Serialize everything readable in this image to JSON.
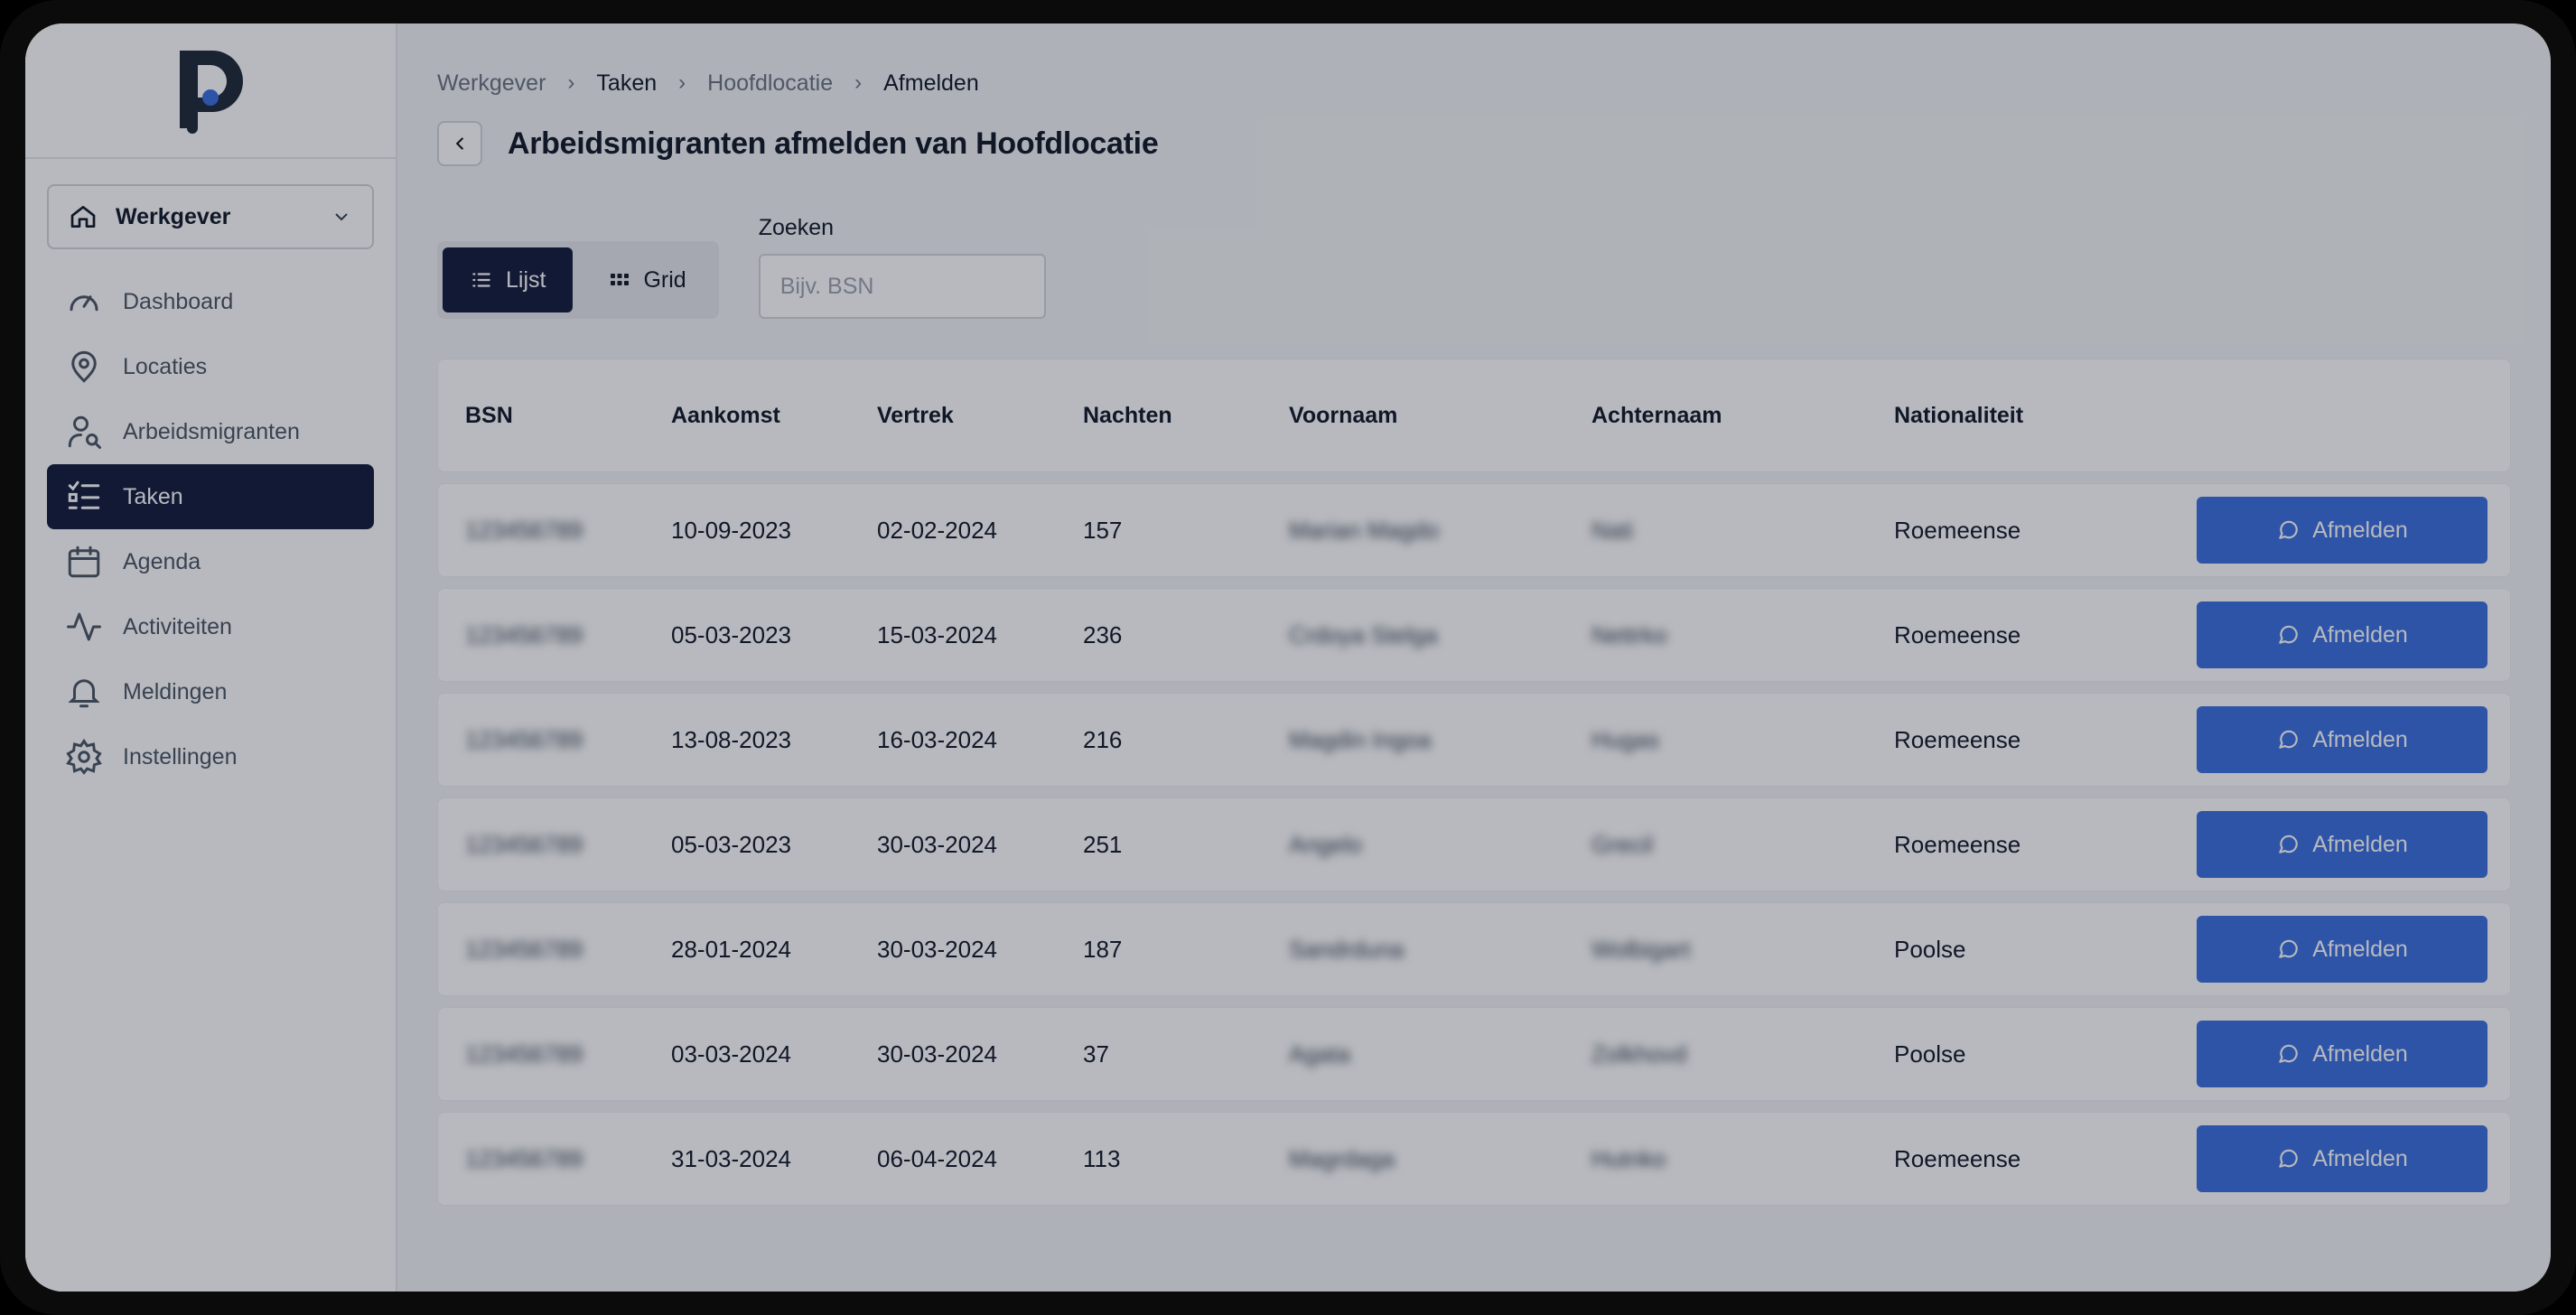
{
  "workspace": {
    "label": "Werkgever"
  },
  "nav": [
    {
      "label": "Dashboard",
      "icon": "gauge-icon",
      "active": false
    },
    {
      "label": "Locaties",
      "icon": "map-pin-icon",
      "active": false
    },
    {
      "label": "Arbeidsmigranten",
      "icon": "user-search-icon",
      "active": false
    },
    {
      "label": "Taken",
      "icon": "task-list-icon",
      "active": true
    },
    {
      "label": "Agenda",
      "icon": "calendar-icon",
      "active": false
    },
    {
      "label": "Activiteiten",
      "icon": "activity-icon",
      "active": false
    },
    {
      "label": "Meldingen",
      "icon": "bell-icon",
      "active": false
    },
    {
      "label": "Instellingen",
      "icon": "gear-icon",
      "active": false
    }
  ],
  "breadcrumb": [
    "Werkgever",
    "Taken",
    "Hoofdlocatie",
    "Afmelden"
  ],
  "page": {
    "title": "Arbeidsmigranten afmelden van Hoofdlocatie"
  },
  "view_toggle": {
    "list_label": "Lijst",
    "grid_label": "Grid",
    "active": "Lijst"
  },
  "search": {
    "label": "Zoeken",
    "placeholder": "Bijv. BSN",
    "value": ""
  },
  "table": {
    "headers": [
      "BSN",
      "Aankomst",
      "Vertrek",
      "Nachten",
      "Voornaam",
      "Achternaam",
      "Nationaliteit",
      ""
    ],
    "action_label": "Afmelden",
    "rows": [
      {
        "bsn": "123456789",
        "aankomst": "10-09-2023",
        "vertrek": "02-02-2024",
        "nachten": "157",
        "voornaam": "Marian Magdo",
        "achternaam": "Nati",
        "nationaliteit": "Roemeense"
      },
      {
        "bsn": "123456789",
        "aankomst": "05-03-2023",
        "vertrek": "15-03-2024",
        "nachten": "236",
        "voornaam": "Crdoya Stelga",
        "achternaam": "Nettrko",
        "nationaliteit": "Roemeense"
      },
      {
        "bsn": "123456789",
        "aankomst": "13-08-2023",
        "vertrek": "16-03-2024",
        "nachten": "216",
        "voornaam": "Magdin Ingoa",
        "achternaam": "Hugas",
        "nationaliteit": "Roemeense"
      },
      {
        "bsn": "123456789",
        "aankomst": "05-03-2023",
        "vertrek": "30-03-2024",
        "nachten": "251",
        "voornaam": "Angelo",
        "achternaam": "Grecil",
        "nationaliteit": "Roemeense"
      },
      {
        "bsn": "123456789",
        "aankomst": "28-01-2024",
        "vertrek": "30-03-2024",
        "nachten": "187",
        "voornaam": "Sandrduna",
        "achternaam": "Wolbigart",
        "nationaliteit": "Poolse"
      },
      {
        "bsn": "123456789",
        "aankomst": "03-03-2024",
        "vertrek": "30-03-2024",
        "nachten": "37",
        "voornaam": "Agata",
        "achternaam": "Zolkhovd",
        "nationaliteit": "Poolse"
      },
      {
        "bsn": "123456789",
        "aankomst": "31-03-2024",
        "vertrek": "06-04-2024",
        "nachten": "113",
        "voornaam": "Magrdaga",
        "achternaam": "Hutnko",
        "nationaliteit": "Roemeense"
      }
    ]
  },
  "colors": {
    "nav_active": "#131a3c",
    "action": "#3b6fe0",
    "logo_dot": "#3b6fe0"
  }
}
